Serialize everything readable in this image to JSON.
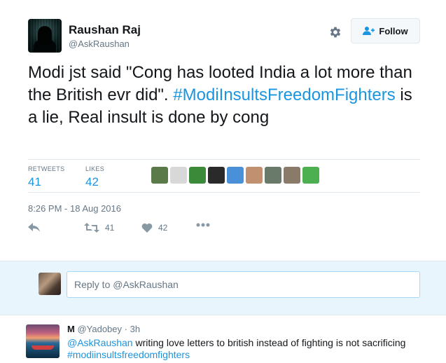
{
  "tweet": {
    "author": {
      "display_name": "Raushan Raj",
      "screen_name": "@AskRaushan"
    },
    "follow_label": "Follow",
    "text": {
      "part1": "Modi jst said \"Cong has looted India a lot more than the British evr did\". ",
      "hashtag": "#ModiInsultsFreedomFighters",
      "part2": " is a lie, Real insult is done by cong"
    },
    "stats": {
      "retweets_label": "RETWEETS",
      "retweets": "41",
      "likes_label": "LIKES",
      "likes": "42"
    },
    "likers": [
      {
        "name": "liker-1",
        "color": "#5a7a4a"
      },
      {
        "name": "liker-2",
        "color": "#d8d8d8"
      },
      {
        "name": "liker-3",
        "color": "#3a8a3a"
      },
      {
        "name": "liker-4",
        "color": "#2a2a2a"
      },
      {
        "name": "liker-5",
        "color": "#4a90d9"
      },
      {
        "name": "liker-6",
        "color": "#c09070"
      },
      {
        "name": "liker-7",
        "color": "#6a7a6a"
      },
      {
        "name": "liker-8",
        "color": "#8a7a6a"
      },
      {
        "name": "liker-9",
        "color": "#4caf50"
      }
    ],
    "timestamp": "8:26 PM - 18 Aug 2016",
    "actions": {
      "retweet_count": "41",
      "like_count": "42"
    }
  },
  "reply_box": {
    "placeholder": "Reply to @AskRaushan"
  },
  "reply": {
    "display_name": "M",
    "screen_name": "@Yadobey",
    "time": "· 3h",
    "mention": "@AskRaushan",
    "text": " writing love letters to british instead of fighting is not sacrificing ",
    "hashtag": "#modiinsultsfreedomfighters"
  },
  "colors": {
    "link": "#1b95e0",
    "muted": "#657786",
    "reply_bg": "#e8f5fd"
  }
}
